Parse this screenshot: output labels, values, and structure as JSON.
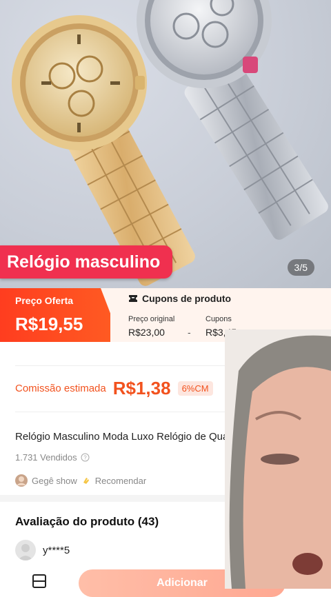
{
  "hero": {
    "title_tag": "Relógio masculino",
    "image_counter": "3/5"
  },
  "price": {
    "offer_label": "Preço Oferta",
    "offer_price": "R$19,55",
    "coupons_header": "Cupons de produto",
    "original_label": "Preço original",
    "original_value": "R$23,00",
    "separator": "-",
    "coupons_label": "Cupons",
    "coupons_value": "R$3,45"
  },
  "commission": {
    "label": "Comissão estimada",
    "value": "R$1,38",
    "badge": "6%CM"
  },
  "product": {
    "title": "Relógio Masculino Moda Luxo Relógio de Quartzo",
    "sold": "1.731 Vendidos",
    "seller": "Gegê show",
    "recommend": "Recomendar"
  },
  "reviews": {
    "title": "Avaliação do produto (43)",
    "reviewer": "y****5"
  },
  "bottom": {
    "add_button": "Adicionar"
  },
  "colors": {
    "accent": "#f2521e",
    "title_tag": "#f0304f",
    "offer_band": "#ff4620"
  },
  "icons": [
    "coupon-icon",
    "info-icon",
    "seller-avatar-icon",
    "clap-icon",
    "user-avatar-icon",
    "store-icon"
  ]
}
